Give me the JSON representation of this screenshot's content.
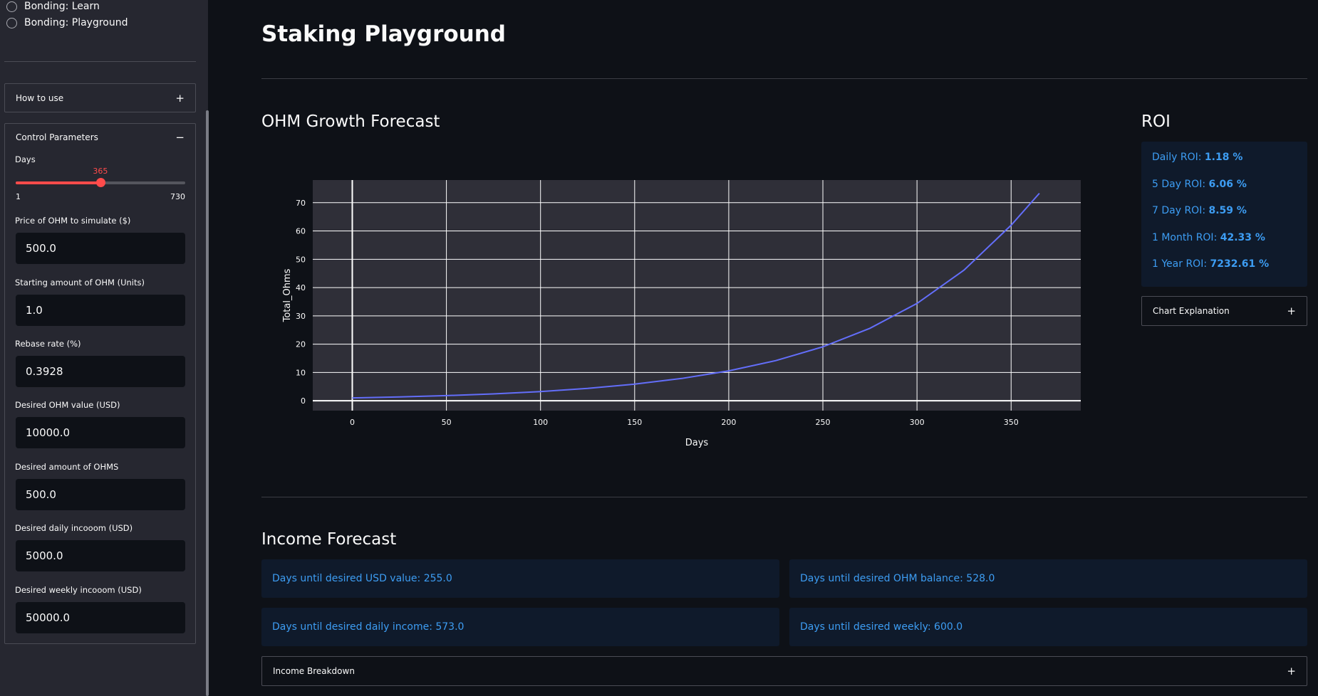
{
  "sidebar": {
    "radios": [
      "Bonding: Learn",
      "Bonding: Playground"
    ],
    "how_to_use": {
      "label": "How to use",
      "sign": "+"
    },
    "control_parameters": {
      "label": "Control Parameters",
      "sign": "−",
      "days": {
        "label": "Days",
        "value": "365",
        "min": "1",
        "max": "730",
        "fraction": 0.4993
      },
      "fields": [
        {
          "label": "Price of OHM to simulate ($)",
          "value": "500.0"
        },
        {
          "label": "Starting amount of OHM (Units)",
          "value": "1.0"
        },
        {
          "label": "Rebase rate (%)",
          "value": "0.3928"
        },
        {
          "label": "Desired OHM value (USD)",
          "value": "10000.0"
        },
        {
          "label": "Desired amount of OHMS",
          "value": "500.0"
        },
        {
          "label": "Desired daily incooom (USD)",
          "value": "5000.0"
        },
        {
          "label": "Desired weekly incooom (USD)",
          "value": "50000.0"
        }
      ]
    }
  },
  "main": {
    "title": "Staking Playground",
    "growth_title": "OHM Growth Forecast",
    "roi": {
      "title": "ROI",
      "items": [
        {
          "label": "Daily ROI: ",
          "value": "1.18 %"
        },
        {
          "label": "5 Day ROI: ",
          "value": "6.06 %"
        },
        {
          "label": "7 Day ROI: ",
          "value": "8.59 %"
        },
        {
          "label": "1 Month ROI: ",
          "value": "42.33 %"
        },
        {
          "label": "1 Year ROI: ",
          "value": "7232.61 %"
        }
      ],
      "chart_explanation": {
        "label": "Chart Explanation",
        "sign": "+"
      }
    },
    "income": {
      "title": "Income Forecast",
      "cards": [
        "Days until desired USD value: 255.0",
        "Days until desired OHM balance: 528.0",
        "Days until desired daily income: 573.0",
        "Days until desired weekly: 600.0"
      ],
      "breakdown": {
        "label": "Income Breakdown",
        "sign": "+"
      }
    }
  },
  "colors": {
    "accent": "#ff4b4b",
    "info": "#3d9df3",
    "line": "#636efa",
    "plot_bg": "#2f2f38"
  },
  "chart_data": {
    "type": "line",
    "xlabel": "Days",
    "ylabel": "Total_Ohms",
    "xlim": [
      -21,
      387
    ],
    "ylim": [
      -3.5,
      78
    ],
    "xticks": [
      0,
      50,
      100,
      150,
      200,
      250,
      300,
      350
    ],
    "yticks": [
      0,
      10,
      20,
      30,
      40,
      50,
      60,
      70
    ],
    "grid": true,
    "series": [
      {
        "x": [
          0,
          25,
          50,
          75,
          100,
          125,
          150,
          175,
          200,
          225,
          250,
          275,
          300,
          325,
          350,
          365
        ],
        "values": [
          1.0,
          1.34,
          1.8,
          2.42,
          3.25,
          4.36,
          5.86,
          7.87,
          10.57,
          14.19,
          19.06,
          25.6,
          34.39,
          46.19,
          62.03,
          73.33
        ]
      }
    ]
  }
}
